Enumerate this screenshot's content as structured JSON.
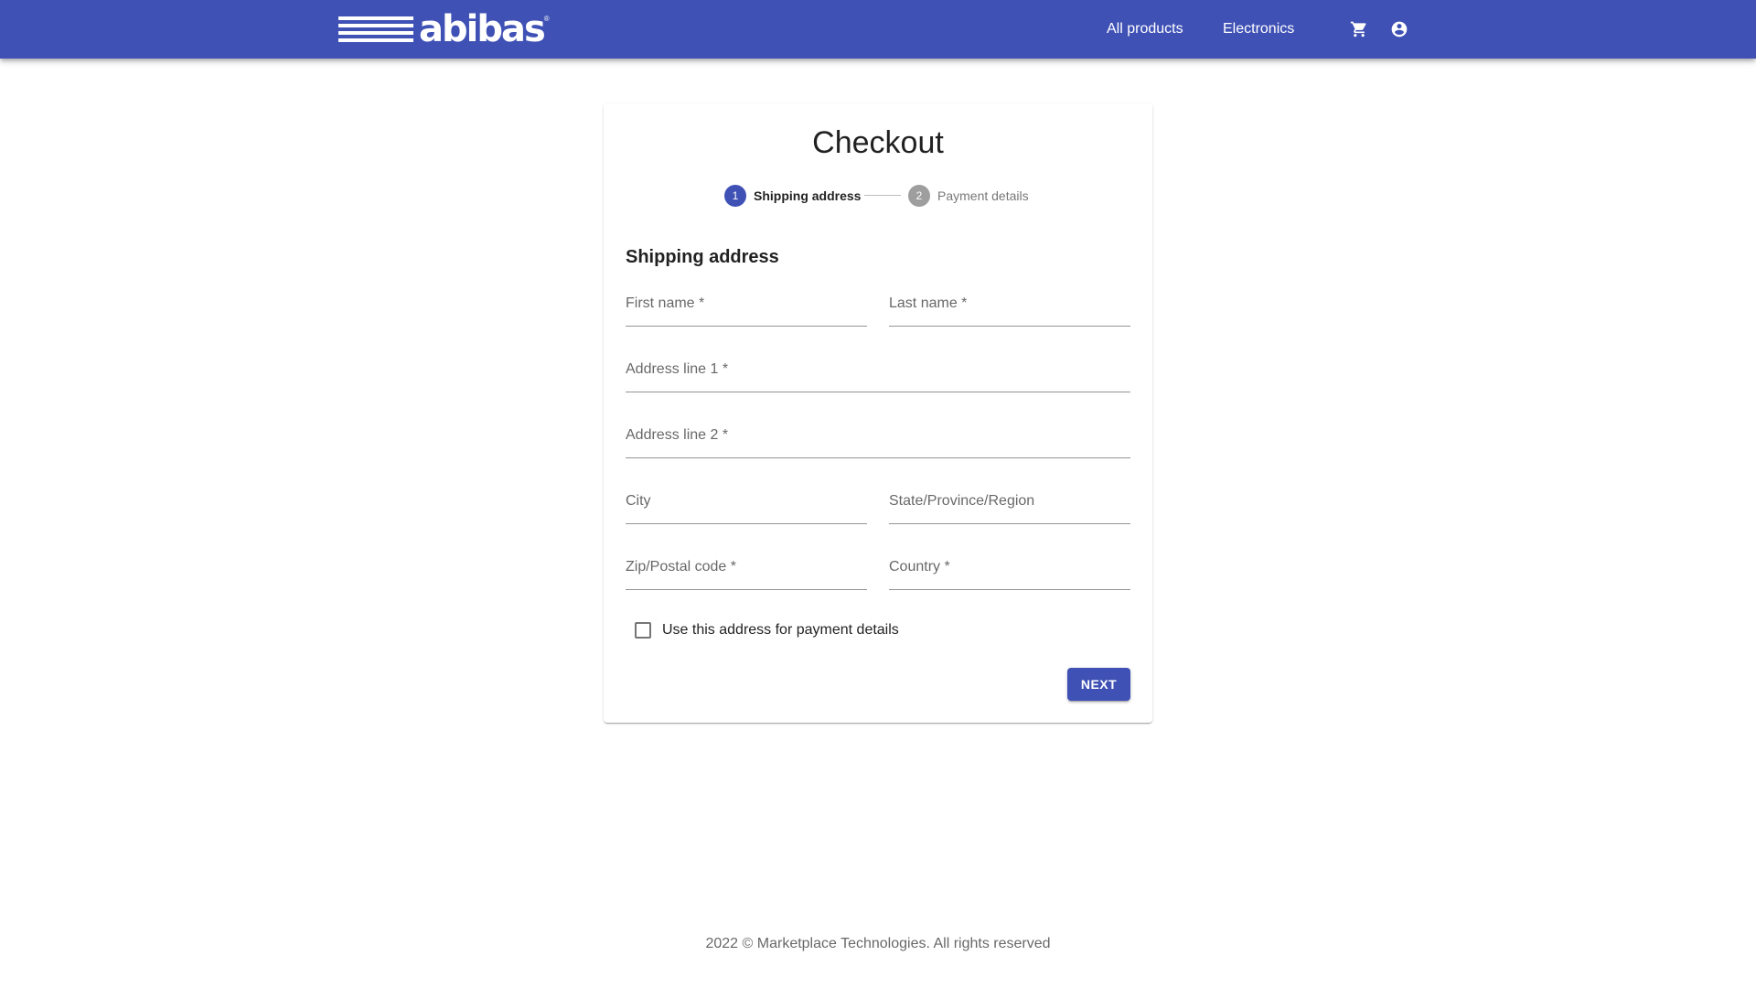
{
  "header": {
    "brand": "abibas",
    "brand_mark": "®",
    "nav": [
      {
        "label": "All products"
      },
      {
        "label": "Electronics"
      }
    ],
    "icons": [
      "cart-icon",
      "account-circle-icon"
    ]
  },
  "checkout": {
    "title": "Checkout",
    "steps": [
      {
        "number": "1",
        "label": "Shipping address",
        "active": true
      },
      {
        "number": "2",
        "label": "Payment details",
        "active": false
      }
    ],
    "section_title": "Shipping address",
    "fields": {
      "first_name": {
        "label": "First name *",
        "value": ""
      },
      "last_name": {
        "label": "Last name *",
        "value": ""
      },
      "address1": {
        "label": "Address line 1 *",
        "value": ""
      },
      "address2": {
        "label": "Address line 2 *",
        "value": ""
      },
      "city": {
        "label": "City",
        "value": ""
      },
      "state": {
        "label": "State/Province/Region",
        "value": ""
      },
      "zip": {
        "label": "Zip/Postal code *",
        "value": ""
      },
      "country": {
        "label": "Country *",
        "value": ""
      }
    },
    "checkbox": {
      "label": "Use this address for payment details",
      "checked": false
    },
    "next_label": "NEXT"
  },
  "footer": {
    "text": "2022 © Marketplace Technologies. All rights reserved"
  },
  "colors": {
    "primary": "#3f51b5",
    "inactive_step": "#9e9e9e"
  }
}
